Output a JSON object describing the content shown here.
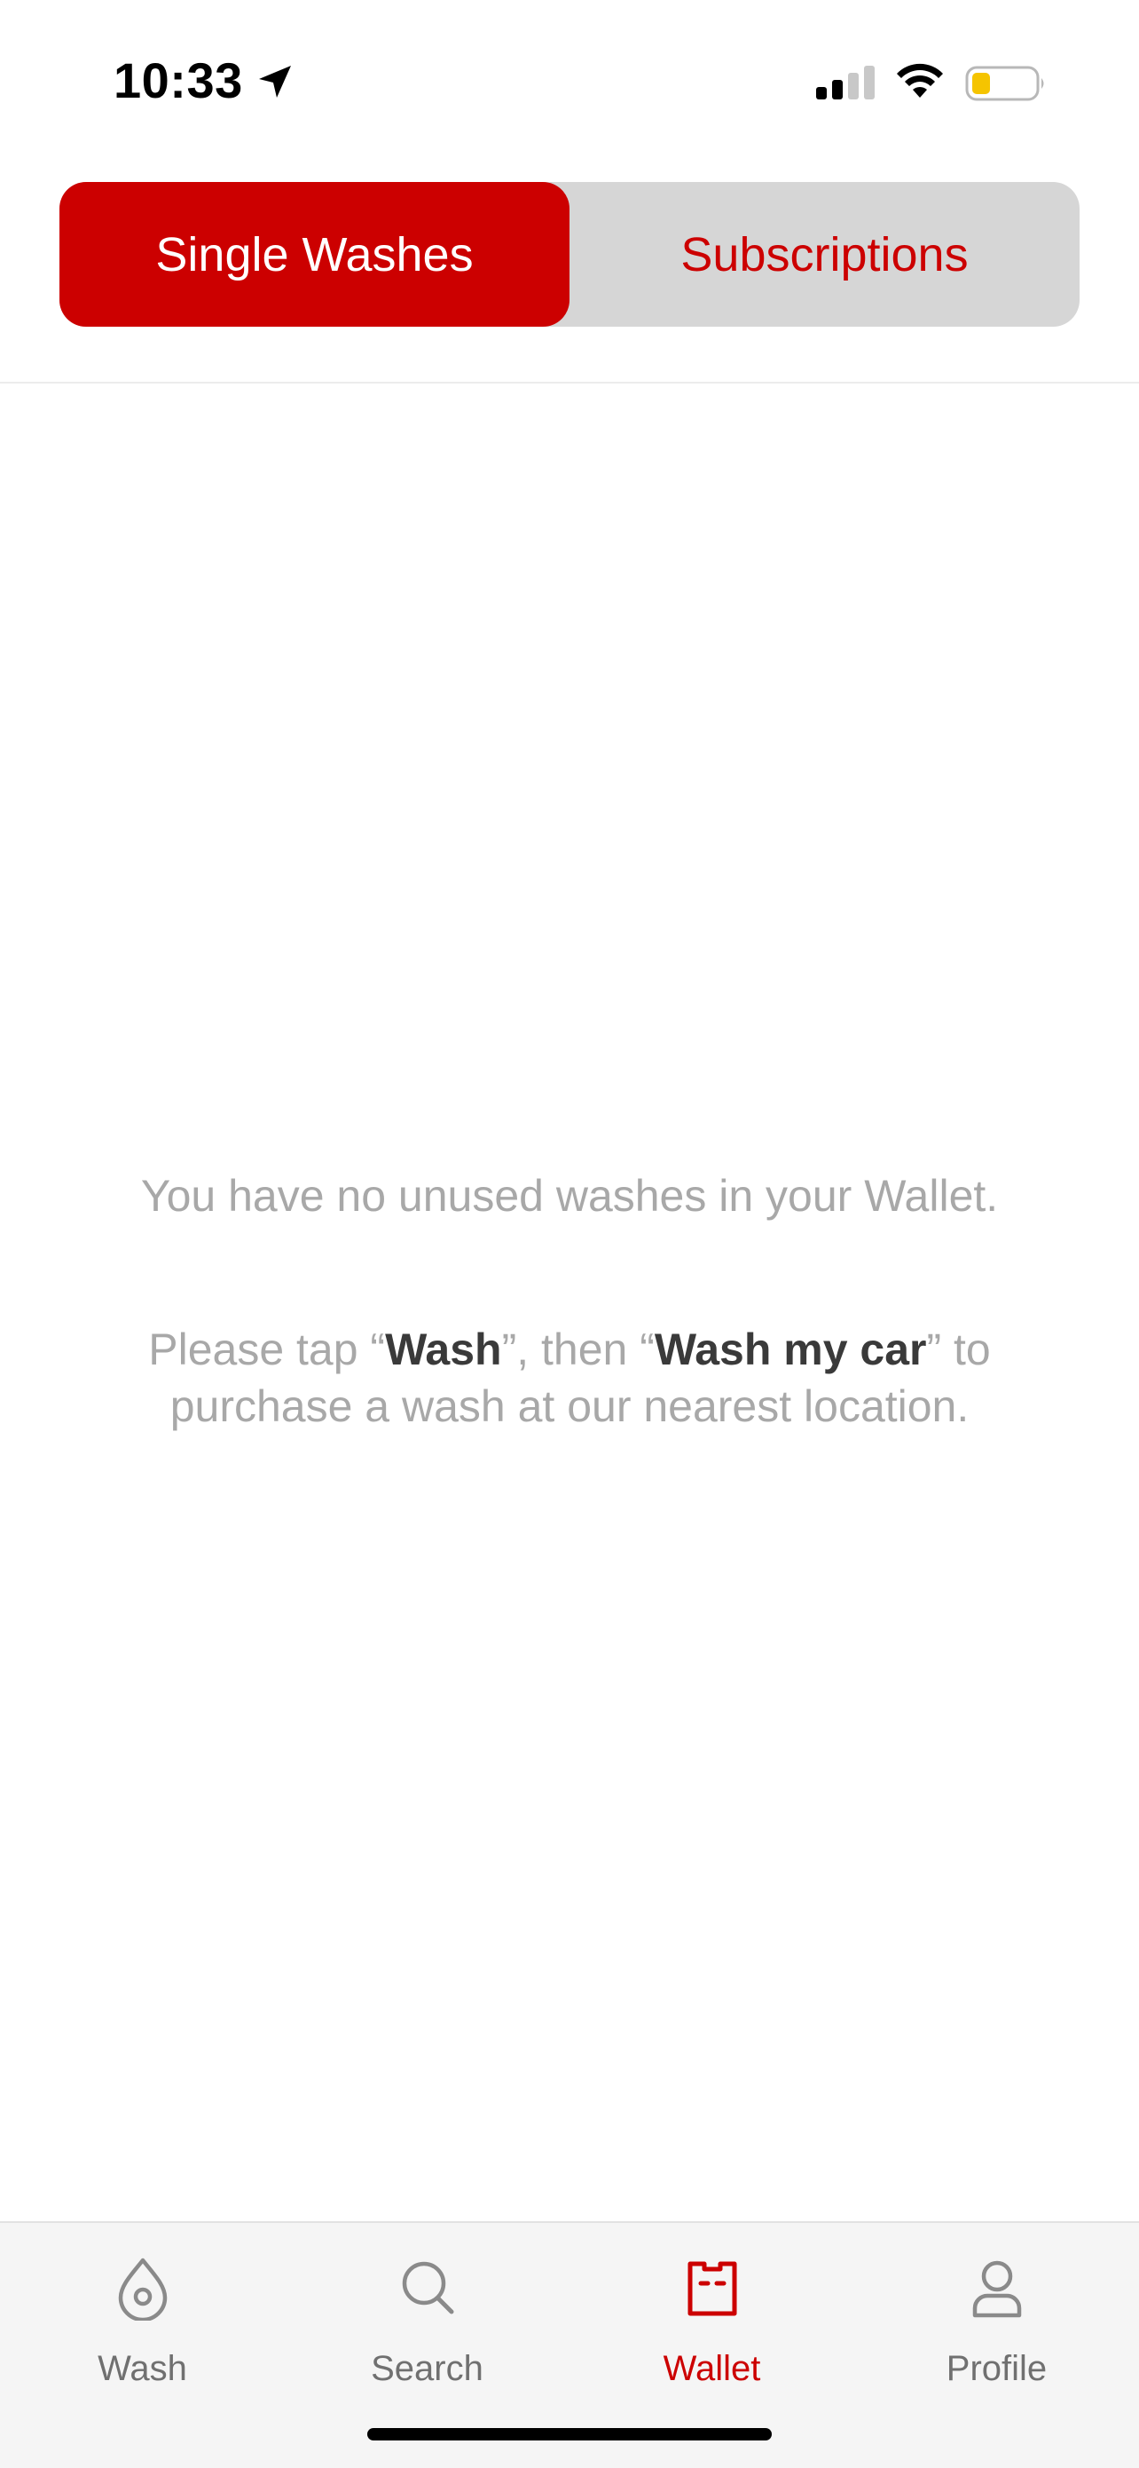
{
  "status_bar": {
    "time": "10:33",
    "battery_color": "#f5c400"
  },
  "segmented_control": {
    "active_label": "Single Washes",
    "inactive_label": "Subscriptions",
    "accent_color": "#cc0000"
  },
  "empty_state": {
    "message": "You have no unused washes in your Wallet.",
    "hint_prefix": "Please tap “",
    "hint_bold_1": "Wash",
    "hint_middle": "”, then “",
    "hint_bold_2": "Wash my car",
    "hint_suffix": "” to purchase a wash at our nearest location."
  },
  "tab_bar": {
    "items": [
      {
        "label": "Wash",
        "icon": "droplet-icon",
        "active": false
      },
      {
        "label": "Search",
        "icon": "search-icon",
        "active": false
      },
      {
        "label": "Wallet",
        "icon": "wallet-icon",
        "active": true
      },
      {
        "label": "Profile",
        "icon": "person-icon",
        "active": false
      }
    ]
  }
}
